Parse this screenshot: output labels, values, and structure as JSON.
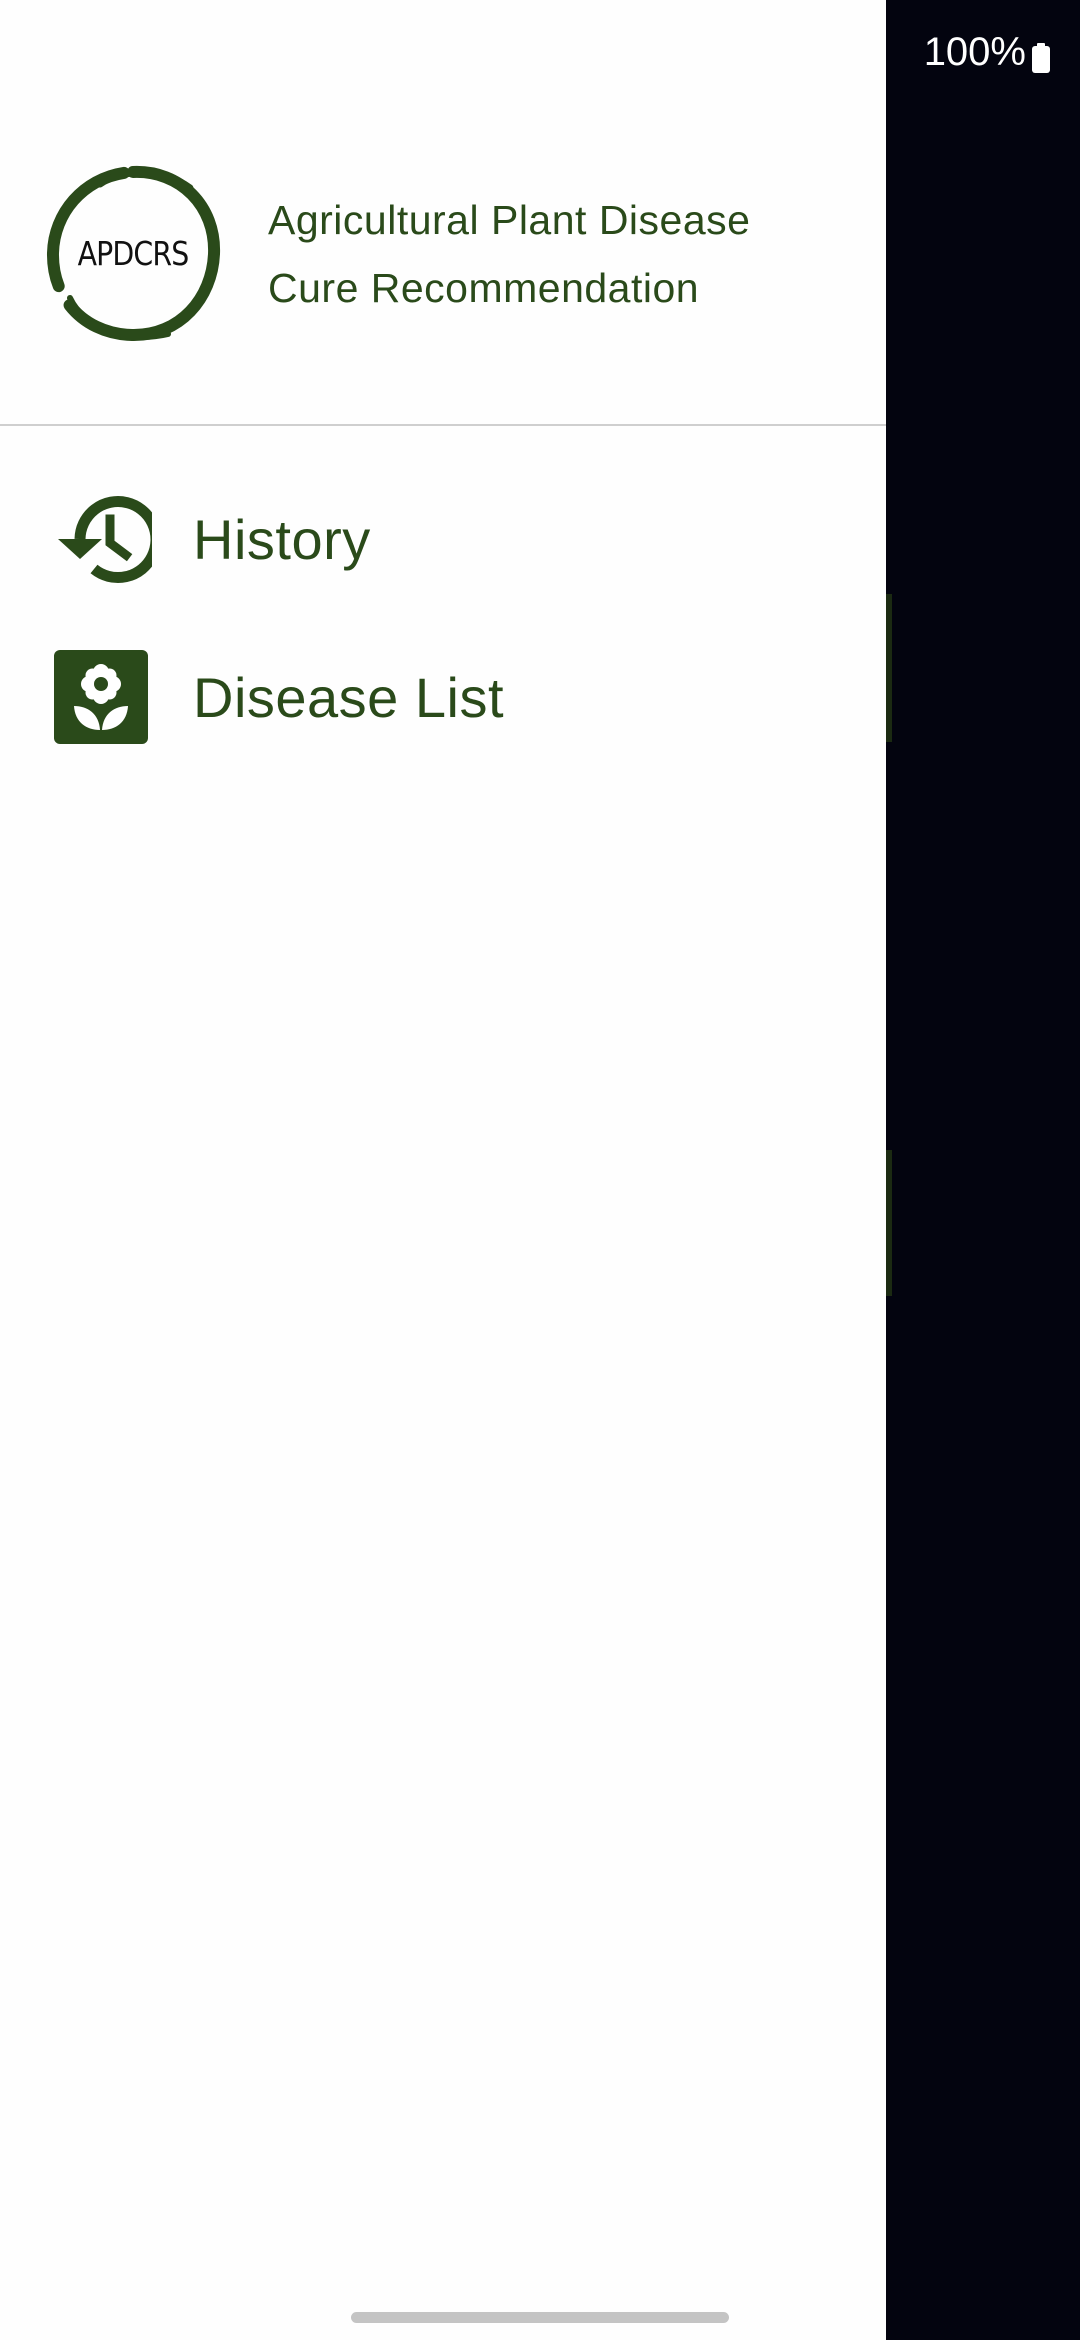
{
  "status_bar": {
    "battery_text": "100%",
    "battery_icon": "battery-full-icon"
  },
  "drawer": {
    "logo_text": "APDCRS",
    "app_name_line1": "Agricultural Plant Disease",
    "app_name_line2": "Cure Recommendation",
    "items": [
      {
        "label": "History",
        "icon": "history-icon"
      },
      {
        "label": "Disease List",
        "icon": "flower-icon"
      }
    ]
  },
  "colors": {
    "primary": "#2a4a1a",
    "scrim": "#03040f",
    "drawer_bg": "#fefefe"
  }
}
